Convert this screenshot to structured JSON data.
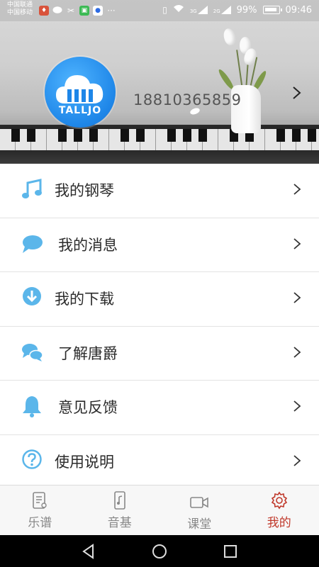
{
  "status_bar": {
    "carrier_1": "中国联通",
    "carrier_2": "中国移动",
    "battery": "99%",
    "time": "09:46",
    "more": "···",
    "net_1": "3G",
    "net_2": "2G"
  },
  "profile": {
    "logo_text": "TALLJO",
    "phone": "18810365859"
  },
  "menu": {
    "items": [
      {
        "label": "我的钢琴",
        "icon": "music-note-icon"
      },
      {
        "label": "我的消息",
        "icon": "chat-bubble-icon"
      },
      {
        "label": "我的下载",
        "icon": "download-icon"
      },
      {
        "label": "了解唐爵",
        "icon": "chat-bubbles-icon"
      },
      {
        "label": "意见反馈",
        "icon": "bell-icon"
      },
      {
        "label": "使用说明",
        "icon": "help-icon"
      }
    ]
  },
  "tabbar": {
    "tabs": [
      {
        "label": "乐谱",
        "icon": "score-icon",
        "active": false
      },
      {
        "label": "音基",
        "icon": "phone-music-icon",
        "active": false
      },
      {
        "label": "课堂",
        "icon": "video-icon",
        "active": false
      },
      {
        "label": "我的",
        "icon": "gear-icon",
        "active": true
      }
    ]
  },
  "colors": {
    "accent_blue": "#5bb6ea",
    "active_tab": "#c0392b",
    "logo_blue": "#1e86e8"
  }
}
